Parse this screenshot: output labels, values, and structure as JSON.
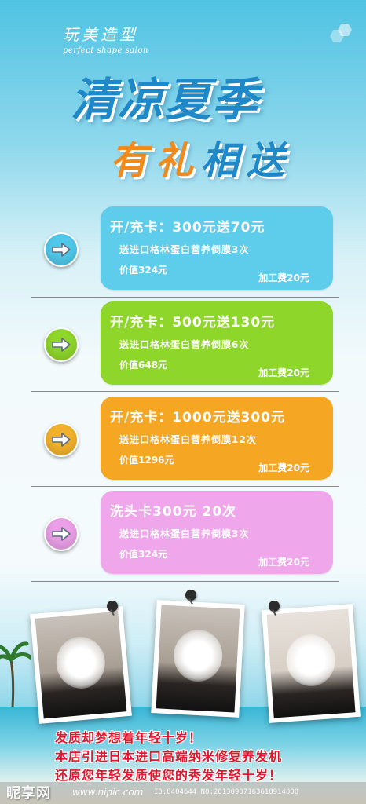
{
  "brand": {
    "name_cn": "玩美造型",
    "name_en": "perfect shape salon"
  },
  "headline": {
    "line1": "清凉夏季",
    "line2_a": "有礼",
    "line2_b": "相送"
  },
  "offers": [
    {
      "title": "开/充卡：300元送70元",
      "line": "送进口格林蛋白营养倒膜3次",
      "value": "价值324元",
      "fee": "加工费20元",
      "color": "#5ecdec",
      "arrow_color": "#4fc8ea"
    },
    {
      "title": "开/充卡：500元送130元",
      "line": "送进口格林蛋白营养倒膜6次",
      "value": "价值648元",
      "fee": "加工费20元",
      "color": "#8fd62b",
      "arrow_color": "#8fd62b"
    },
    {
      "title": "开/充卡：1000元送300元",
      "line": "送进口格林蛋白营养倒膜12次",
      "value": "价值1296元",
      "fee": "加工费20元",
      "color": "#f5a623",
      "arrow_color": "#f2b12c"
    },
    {
      "title": "洗头卡300元    20次",
      "line": "送进口格林蛋白营养倒模3次",
      "value": "价值324元",
      "fee": "加工费20元",
      "color": "#f0a6ea",
      "arrow_color": "#ea9fe6"
    }
  ],
  "slogans": [
    "发质却梦想着年轻十岁！",
    "本店引进日本进口高端纳米修复养发机",
    "还原您年轻发质使您的秀发年轻十岁！"
  ],
  "watermark": {
    "logo": "昵享网",
    "url": "www.nipic.com",
    "id": "ID:8404644 NO:20130907163618914000"
  },
  "icons": {
    "arrow": "arrow-right-icon",
    "pin": "pushpin-icon"
  }
}
